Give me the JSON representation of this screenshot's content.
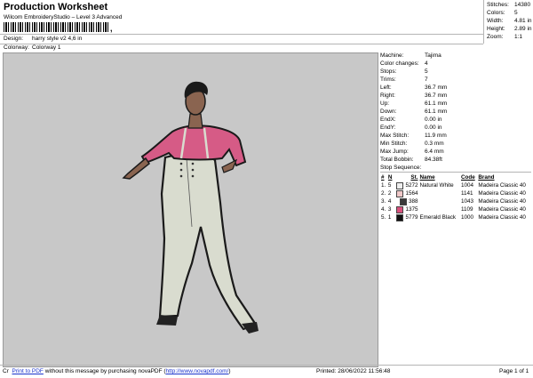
{
  "header": {
    "title": "Production Worksheet",
    "subtitle": "Wilcom EmbroideryStudio – Level 3 Advanced",
    "barcode_mark": ",",
    "design_label": "Design:",
    "design_value": "harry style v2 4,6 in",
    "colorway_label": "Colorway:",
    "colorway_value": "Colorway 1"
  },
  "stats": [
    {
      "label": "Stitches:",
      "value": "14380"
    },
    {
      "label": "Colors:",
      "value": "5"
    },
    {
      "label": "Width:",
      "value": "4.81 in"
    },
    {
      "label": "Height:",
      "value": "2.89 in"
    },
    {
      "label": "Zoom:",
      "value": "1:1"
    }
  ],
  "details": [
    {
      "label": "Machine:",
      "value": "Tajima"
    },
    {
      "label": "Color changes:",
      "value": "4"
    },
    {
      "label": "Stops:",
      "value": "5"
    },
    {
      "label": "Trims:",
      "value": "7"
    },
    {
      "label": "Left:",
      "value": "36.7 mm"
    },
    {
      "label": "Right:",
      "value": "36.7 mm"
    },
    {
      "label": "Up:",
      "value": "61.1 mm"
    },
    {
      "label": "Down:",
      "value": "61.1 mm"
    },
    {
      "label": "EndX:",
      "value": "0.00 in"
    },
    {
      "label": "EndY:",
      "value": "0.00 in"
    },
    {
      "label": "Max Stitch:",
      "value": "11.9 mm"
    },
    {
      "label": "Min Stitch:",
      "value": "0.3 mm"
    },
    {
      "label": "Max Jump:",
      "value": "6.4 mm"
    },
    {
      "label": "Total Bobbin:",
      "value": "84.38ft"
    }
  ],
  "stop_sequence": {
    "label": "Stop Sequence:",
    "columns": [
      "#",
      "N",
      "St.",
      "Name",
      "Code",
      "Brand"
    ],
    "rows": [
      {
        "num": "1.",
        "n": "5",
        "color": "#eeeeee",
        "st": "5272",
        "name": "Natural White",
        "code": "1004",
        "brand": "Madeira Classic 40"
      },
      {
        "num": "2.",
        "n": "2",
        "color": "#f0c8c8",
        "st": "1564",
        "name": "",
        "code": "1141",
        "brand": "Madeira Classic 40"
      },
      {
        "num": "3.",
        "n": "4",
        "color": "#3a3a3a",
        "st": "388",
        "name": "",
        "code": "1043",
        "brand": "Madeira Classic 40"
      },
      {
        "num": "4.",
        "n": "3",
        "color": "#d9507c",
        "st": "1375",
        "name": "",
        "code": "1109",
        "brand": "Madeira Classic 40"
      },
      {
        "num": "5.",
        "n": "1",
        "color": "#111111",
        "st": "5779",
        "name": "Emerald Black",
        "code": "1000",
        "brand": "Madeira Classic 40"
      }
    ]
  },
  "footer": {
    "prefix": "Cr",
    "link": "Print to PDF",
    "text": "without this message by purchasing novaPDF (",
    "url": "http://www.novapdf.com/",
    "suffix": ")",
    "printed": "Printed: 28/06/2022 11:56:48",
    "page": "Page 1 of 1"
  }
}
